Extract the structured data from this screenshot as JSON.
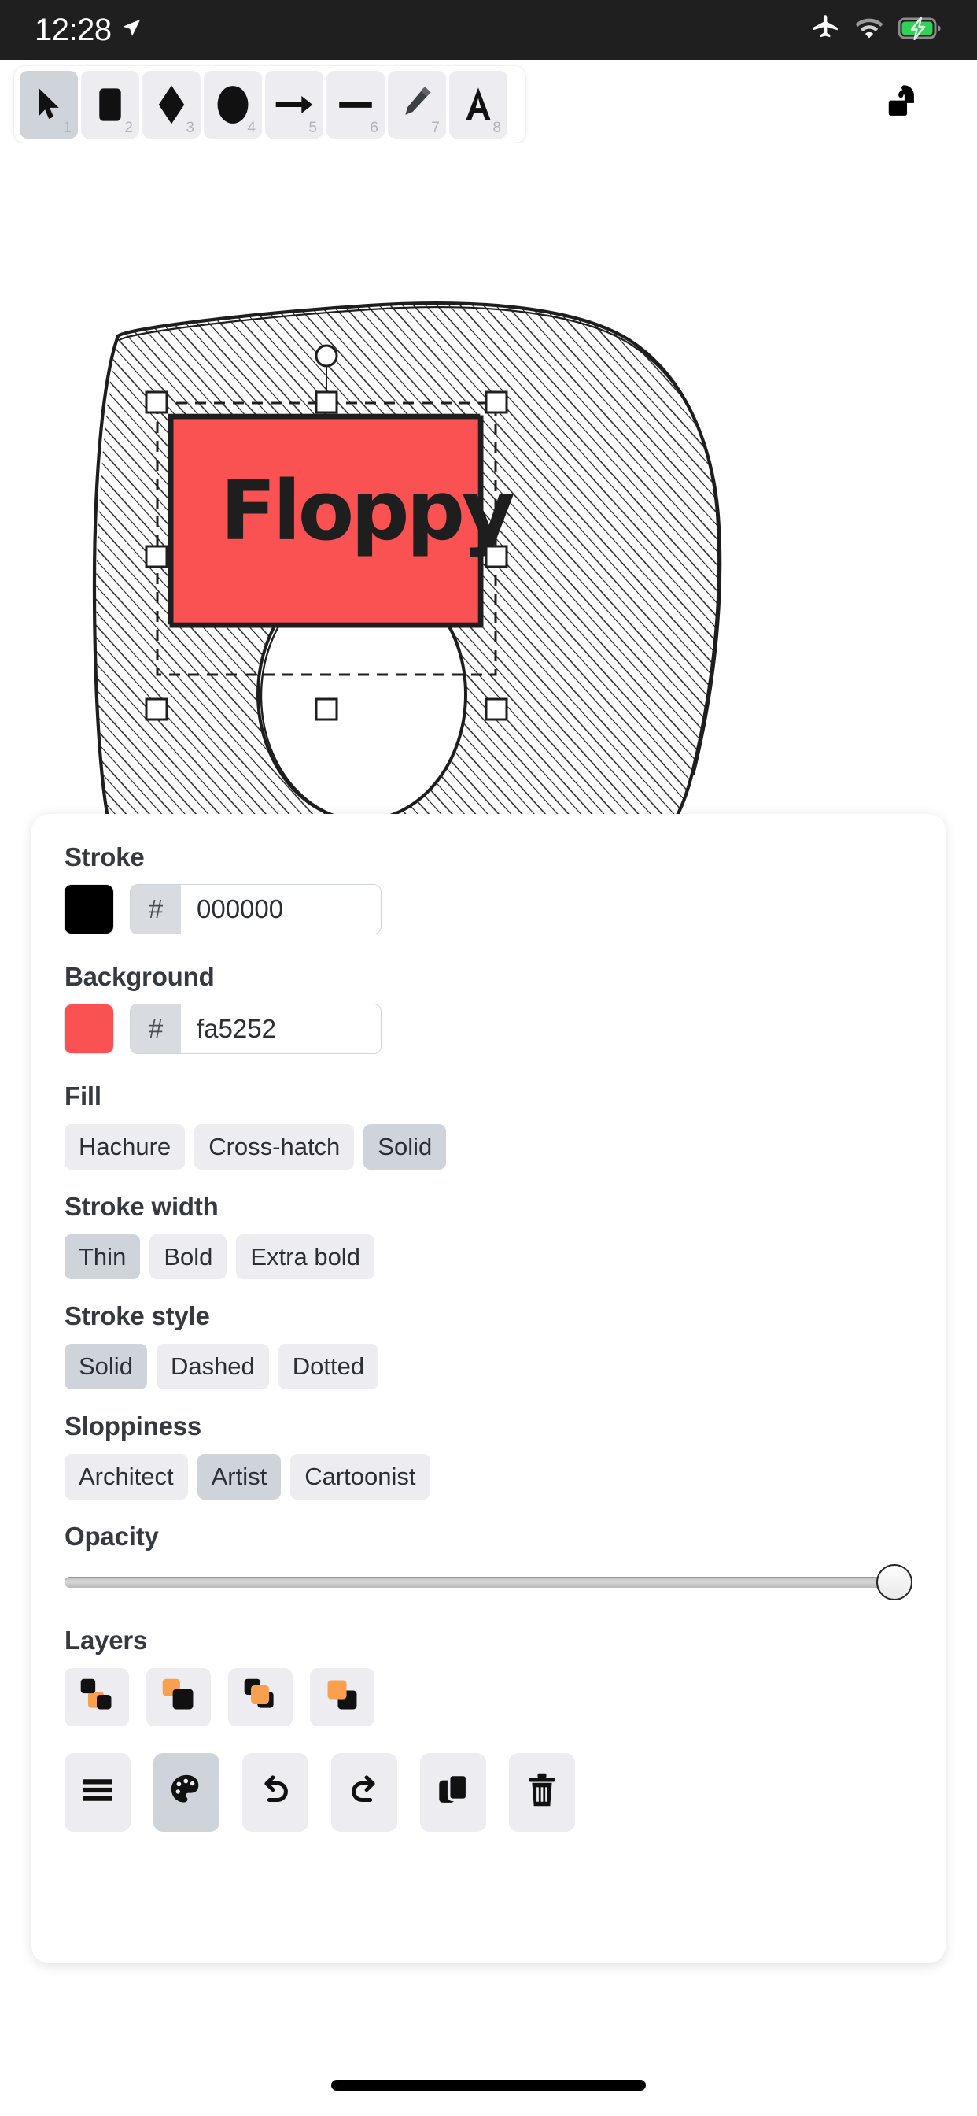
{
  "status_bar": {
    "time": "12:28",
    "icons": [
      "location-arrow-icon",
      "airplane-mode-icon",
      "wifi-icon",
      "battery-charging-icon"
    ],
    "background_color": "#1f1f1f",
    "battery_color": "#30d158"
  },
  "toolbar": {
    "tools": [
      {
        "name": "selection-tool",
        "icon": "cursor-icon",
        "shortcut": "1",
        "active": true
      },
      {
        "name": "rectangle-tool",
        "icon": "square-icon",
        "shortcut": "2",
        "active": false
      },
      {
        "name": "diamond-tool",
        "icon": "diamond-icon",
        "shortcut": "3",
        "active": false
      },
      {
        "name": "ellipse-tool",
        "icon": "circle-icon",
        "shortcut": "4",
        "active": false
      },
      {
        "name": "arrow-tool",
        "icon": "arrow-icon",
        "shortcut": "5",
        "active": false
      },
      {
        "name": "line-tool",
        "icon": "line-icon",
        "shortcut": "6",
        "active": false
      },
      {
        "name": "draw-tool",
        "icon": "pencil-icon",
        "shortcut": "7",
        "active": false
      },
      {
        "name": "text-tool",
        "icon": "letter-a-icon",
        "shortcut": "8",
        "active": false
      }
    ],
    "lock": {
      "name": "lock-toggle",
      "icon": "unlocked-padlock-icon",
      "locked": false
    }
  },
  "canvas": {
    "shape_label": "Floppy",
    "shape_fill": "#fa5252",
    "shape_stroke": "#1e1e1e",
    "selection_handles": 8,
    "rotation_handle": true
  },
  "properties": {
    "stroke": {
      "label": "Stroke",
      "hash": "#",
      "value": "000000",
      "swatch_color": "#000000"
    },
    "background": {
      "label": "Background",
      "hash": "#",
      "value": "fa5252",
      "swatch_color": "#fa5252"
    },
    "fill": {
      "label": "Fill",
      "options": [
        "Hachure",
        "Cross-hatch",
        "Solid"
      ],
      "selected": "Solid"
    },
    "stroke_width": {
      "label": "Stroke width",
      "options": [
        "Thin",
        "Bold",
        "Extra bold"
      ],
      "selected": "Thin"
    },
    "stroke_style": {
      "label": "Stroke style",
      "options": [
        "Solid",
        "Dashed",
        "Dotted"
      ],
      "selected": "Solid"
    },
    "sloppiness": {
      "label": "Sloppiness",
      "options": [
        "Architect",
        "Artist",
        "Cartoonist"
      ],
      "selected": "Artist"
    },
    "opacity": {
      "label": "Opacity",
      "value": 100,
      "min": 0,
      "max": 100
    },
    "layers": {
      "label": "Layers",
      "buttons": [
        {
          "name": "send-to-back-button",
          "icon": "send-to-back-icon"
        },
        {
          "name": "send-backward-button",
          "icon": "send-backward-icon"
        },
        {
          "name": "bring-forward-button",
          "icon": "bring-forward-icon"
        },
        {
          "name": "bring-to-front-button",
          "icon": "bring-to-front-icon"
        }
      ],
      "accent_color": "#f9a04f"
    }
  },
  "action_bar": {
    "buttons": [
      {
        "name": "menu-button",
        "icon": "hamburger-icon",
        "active": false
      },
      {
        "name": "palette-button",
        "icon": "palette-icon",
        "active": true
      },
      {
        "name": "undo-button",
        "icon": "undo-icon",
        "active": false
      },
      {
        "name": "redo-button",
        "icon": "redo-icon",
        "active": false
      },
      {
        "name": "duplicate-button",
        "icon": "duplicate-icon",
        "active": false
      },
      {
        "name": "delete-button",
        "icon": "trash-icon",
        "active": false
      }
    ]
  }
}
